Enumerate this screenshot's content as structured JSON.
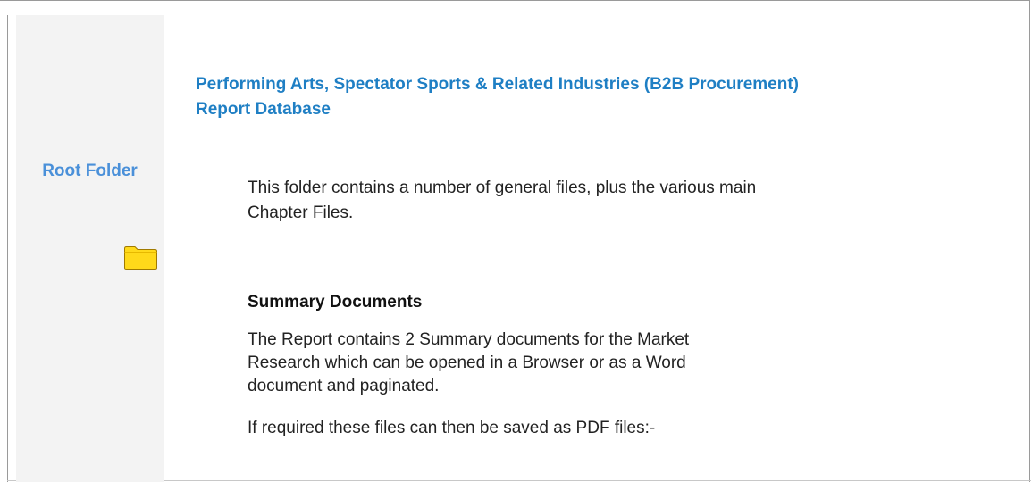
{
  "sidebar": {
    "title": "Root Folder",
    "icon": "folder-icon"
  },
  "main": {
    "title": "Performing Arts, Spectator Sports & Related Industries (B2B Procurement) Report Database",
    "intro": "This folder contains a number of general files, plus the various main Chapter Files.",
    "section_heading": "Summary Documents",
    "section_text": "The Report contains 2 Summary documents for the Market Research which can be opened in a Browser or as a Word document and paginated.",
    "section_note": "If required these files can then be saved as PDF files:-"
  },
  "colors": {
    "sidebar_bg": "#f3f3f3",
    "title_blue": "#1f7fc4",
    "sidebar_blue": "#4a90d9",
    "folder_yellow": "#ffd91a",
    "frame_border": "#9a9a9a"
  }
}
